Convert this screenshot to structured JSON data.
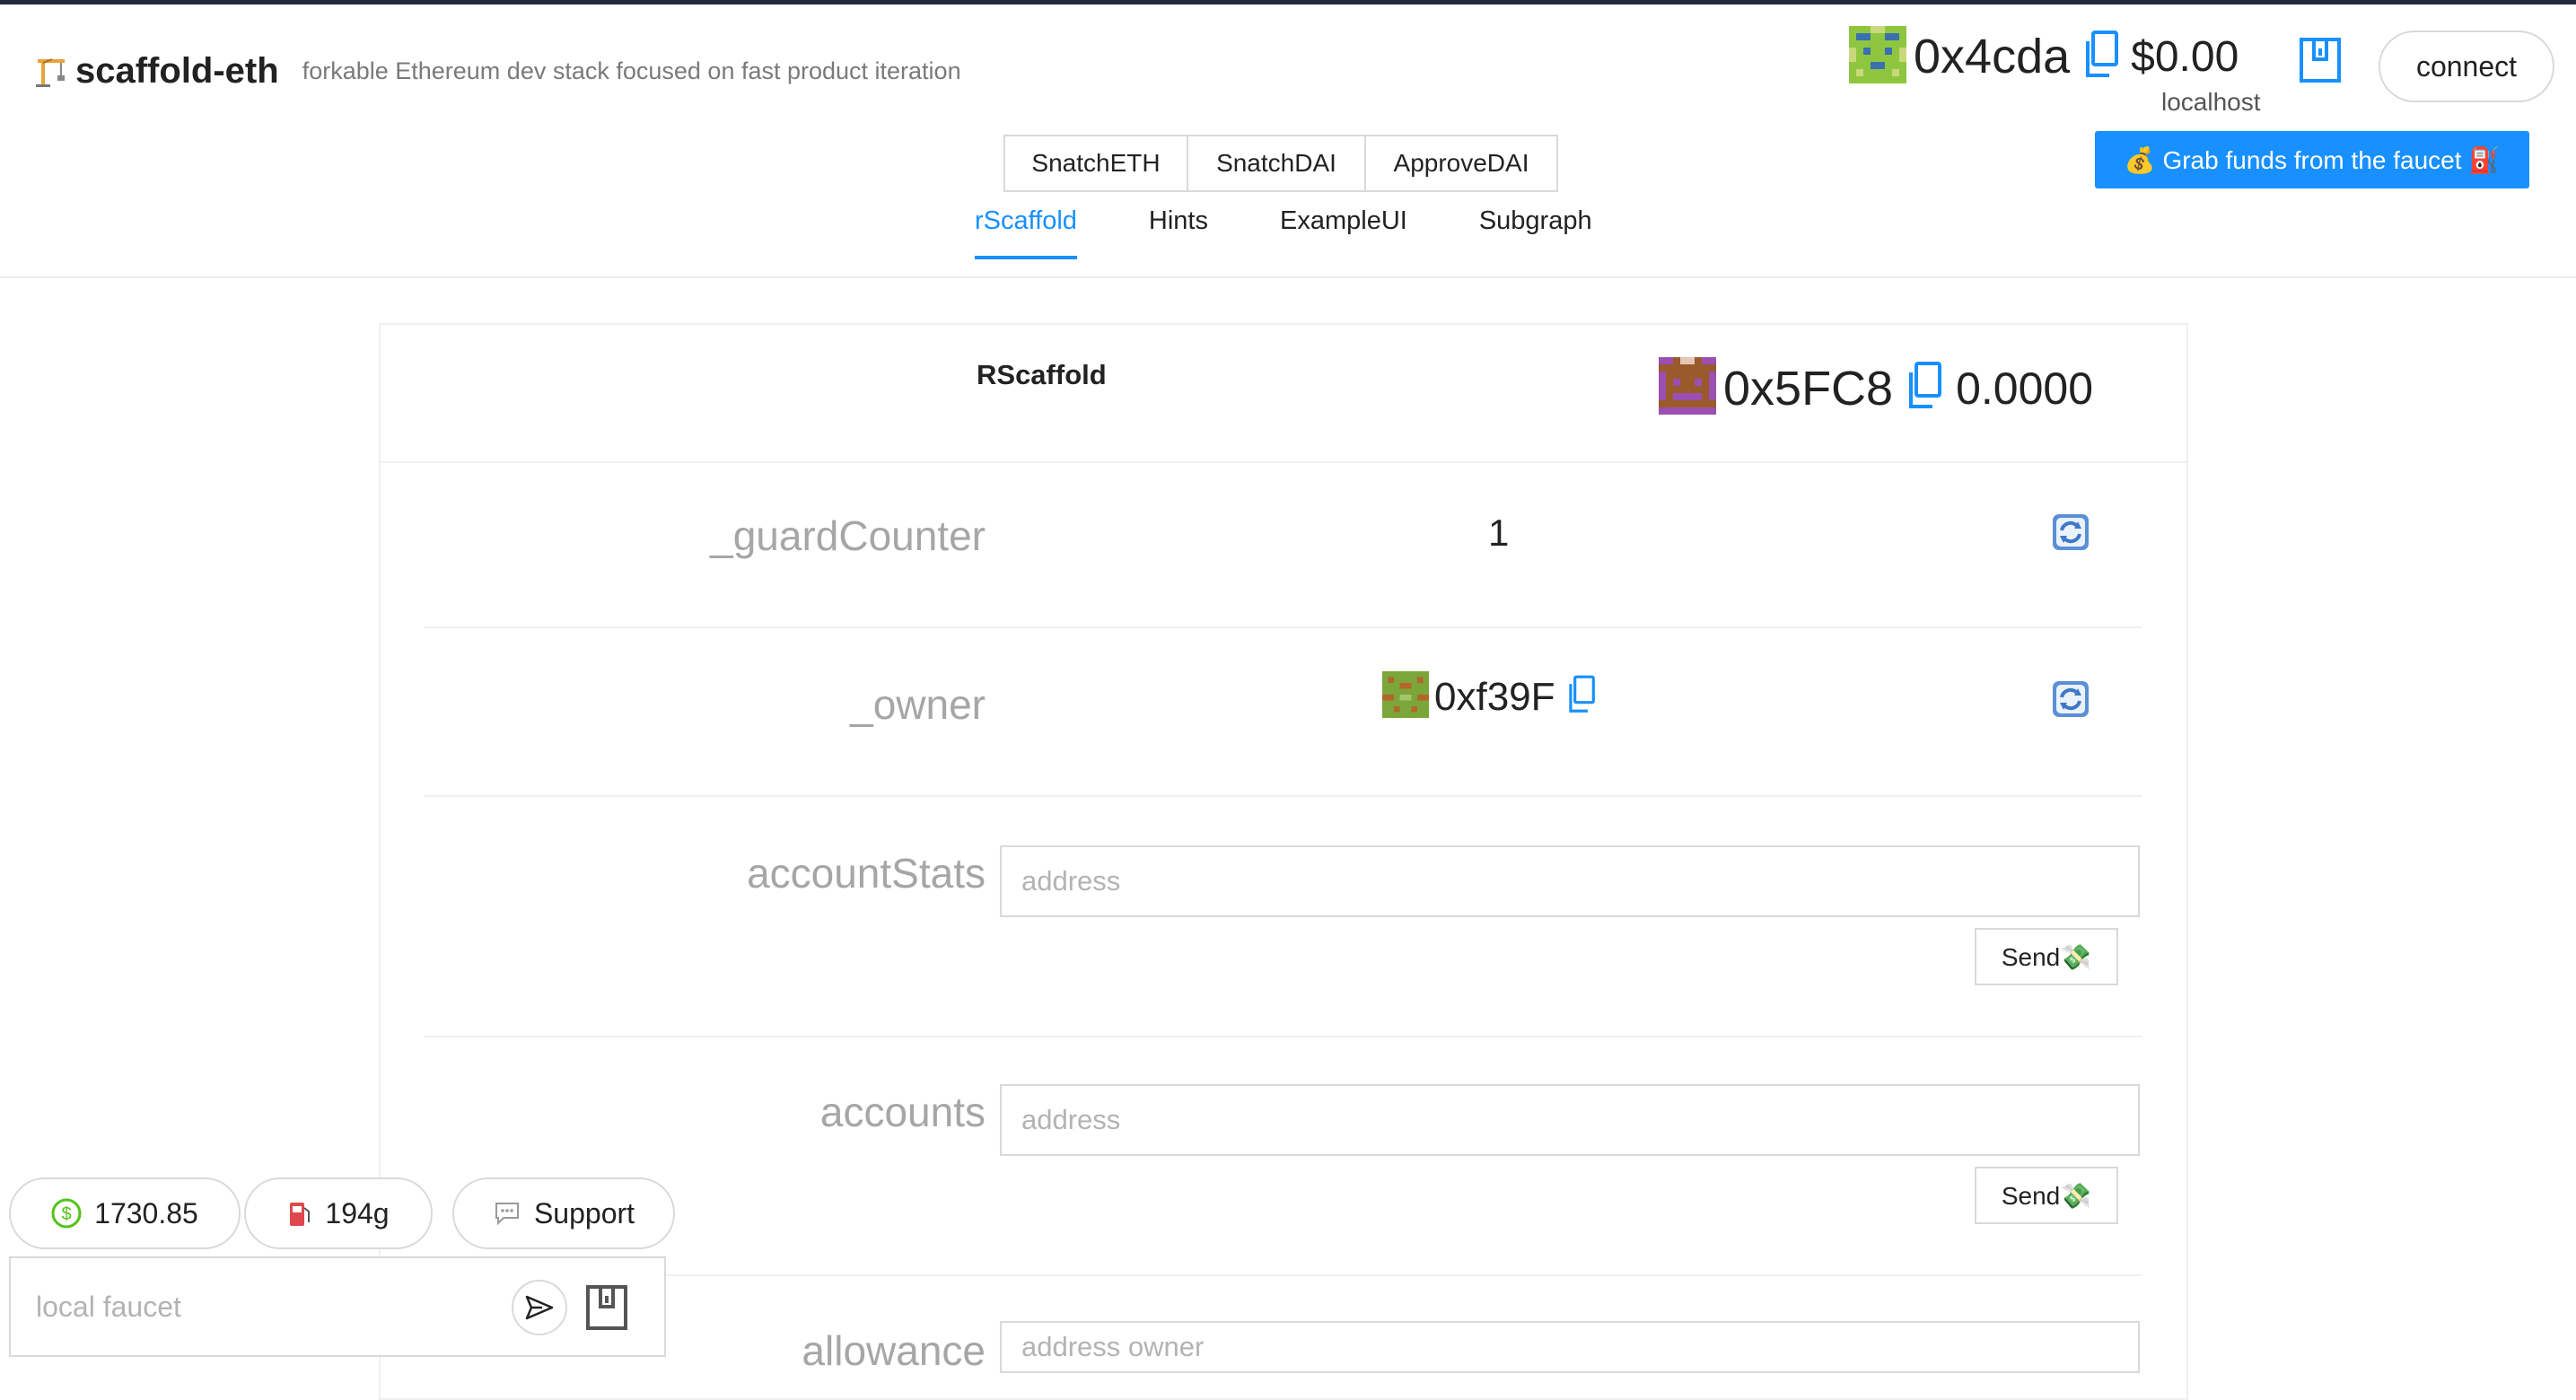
{
  "header": {
    "brand_emoji": "🏗",
    "title": "scaffold-eth",
    "subtitle": "forkable Ethereum dev stack focused on fast product iteration",
    "account_address": "0x4cda",
    "account_balance": "$0.00",
    "network": "localhost",
    "connect_label": "connect",
    "faucet_button_label": "💰 Grab funds from the faucet ⛽️"
  },
  "actions": {
    "buttons": [
      "SnatchETH",
      "SnatchDAI",
      "ApproveDAI"
    ]
  },
  "tabs": {
    "items": [
      "rScaffold",
      "Hints",
      "ExampleUI",
      "Subgraph"
    ],
    "active": "rScaffold"
  },
  "contract": {
    "name": "RScaffold",
    "address": "0x5FC8",
    "balance": "0.0000",
    "vars": {
      "guard_counter": {
        "label": "_guardCounter",
        "value": "1"
      },
      "owner": {
        "label": "_owner",
        "value": "0xf39F"
      }
    },
    "functions": {
      "account_stats": {
        "label": "accountStats",
        "placeholder": "address",
        "send_label": "Send💸"
      },
      "accounts": {
        "label": "accounts",
        "placeholder": "address",
        "send_label": "Send💸"
      },
      "allowance": {
        "label": "allowance",
        "placeholder": "address owner"
      }
    }
  },
  "footer": {
    "eth_price": "1730.85",
    "gas_price": "194g",
    "support_label": "Support",
    "faucet_placeholder": "local faucet"
  },
  "icons": {
    "copy": "copy-icon",
    "wallet": "wallet-icon",
    "refresh": "refresh-icon",
    "send": "send-arrow-icon",
    "dollar": "dollar-icon",
    "fuel": "fuel-pump-icon",
    "chat": "chat-bubble-icon"
  },
  "colors": {
    "accent": "#1890ff",
    "topbar": "#1e2a3b",
    "label_gray": "#a6a6a6",
    "border": "#d9d9d9"
  }
}
